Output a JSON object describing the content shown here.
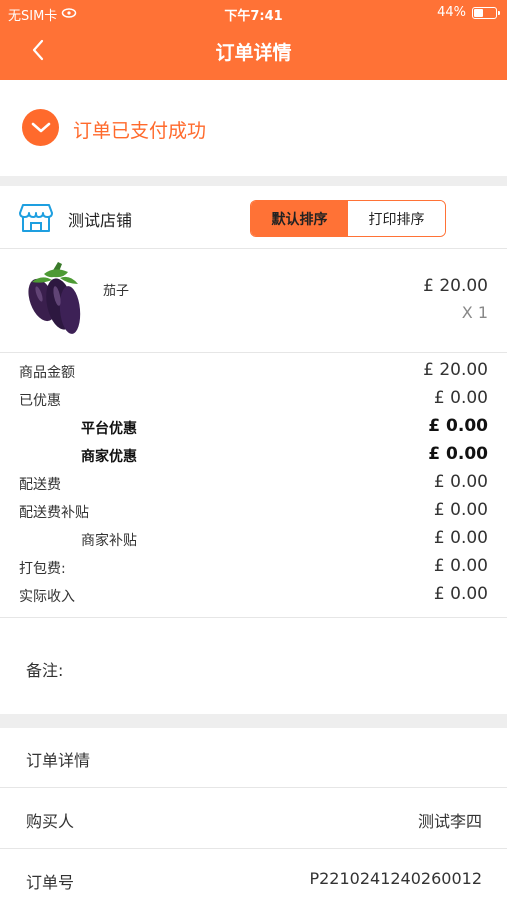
{
  "status_bar": {
    "carrier": "无SIM卡",
    "time": "下午7:41",
    "battery": "44%",
    "battery_level": 0.44
  },
  "nav": {
    "back_icon": "chevron-left-icon",
    "title": "订单详情"
  },
  "success": {
    "icon": "check-circle-icon",
    "text": "订单已支付成功"
  },
  "store": {
    "icon": "store-icon",
    "name": "测试店铺",
    "sort_default": "默认排序",
    "sort_print": "打印排序"
  },
  "product": {
    "image": "eggplant-image",
    "name": "茄子",
    "price": "£ 20.00",
    "qty": "X 1"
  },
  "amounts": [
    {
      "label": "商品金额",
      "value": "£ 20.00"
    },
    {
      "label": "已优惠",
      "value": "£ 0.00"
    },
    {
      "label": "平台优惠",
      "value": "£ 0.00"
    },
    {
      "label": "商家优惠",
      "value": "£ 0.00"
    },
    {
      "label": "配送费",
      "value": "£ 0.00"
    },
    {
      "label": "配送费补贴",
      "value": "£ 0.00"
    },
    {
      "label": "商家补贴",
      "value": "£ 0.00"
    },
    {
      "label": "打包费:",
      "value": "£ 0.00"
    },
    {
      "label": "实际收入",
      "value": "£ 0.00"
    }
  ],
  "remark": {
    "label": "备注:"
  },
  "detail": {
    "section_title": "订单详情",
    "buyer_label": "购买人",
    "buyer_value": "测试李四",
    "order_no_label": "订单号",
    "order_no_value": "P2210241240260012"
  },
  "colors": {
    "brand": "#ff7236",
    "success": "#ff6a2c",
    "divider": "#eeeeee"
  }
}
